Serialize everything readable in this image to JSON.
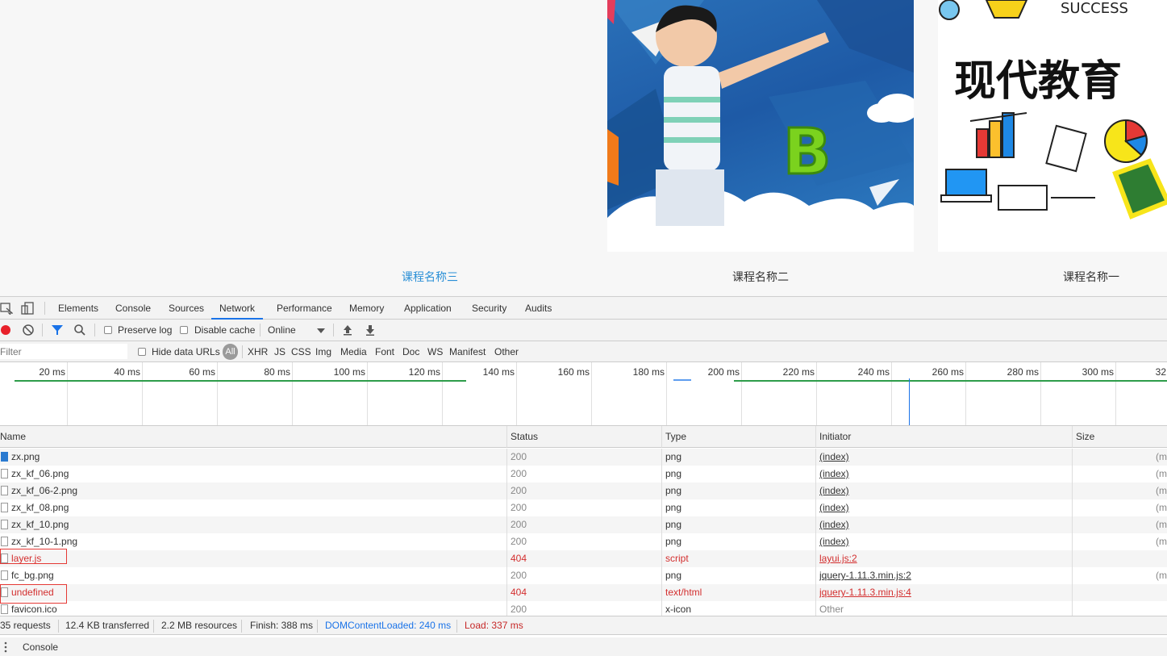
{
  "courses": [
    "课程名称三",
    "课程名称二",
    "课程名称一"
  ],
  "hero_images": {
    "image1_text": "B",
    "image2_title": "现代教育",
    "image2_top": "SUCCESS"
  },
  "devtools": {
    "tabs": [
      "Elements",
      "Console",
      "Sources",
      "Network",
      "Performance",
      "Memory",
      "Application",
      "Security",
      "Audits"
    ],
    "selected_tab": "Network",
    "toolbar": {
      "preserve_log": "Preserve log",
      "disable_cache": "Disable cache",
      "throttle": "Online"
    },
    "filterbar": {
      "placeholder": "Filter",
      "hide_data_urls": "Hide data URLs",
      "all": "All",
      "types": [
        "XHR",
        "JS",
        "CSS",
        "Img",
        "Media",
        "Font",
        "Doc",
        "WS",
        "Manifest",
        "Other"
      ]
    },
    "timeline_ticks": [
      "20 ms",
      "40 ms",
      "60 ms",
      "80 ms",
      "100 ms",
      "120 ms",
      "140 ms",
      "160 ms",
      "180 ms",
      "200 ms",
      "220 ms",
      "240 ms",
      "260 ms",
      "280 ms",
      "300 ms",
      "32"
    ],
    "columns": [
      "Name",
      "Status",
      "Type",
      "Initiator",
      "Size"
    ],
    "rows": [
      {
        "name": "zx.png",
        "status": "200",
        "type": "png",
        "initiator": "(index)",
        "size": "(m"
      },
      {
        "name": "zx_kf_06.png",
        "status": "200",
        "type": "png",
        "initiator": "(index)",
        "size": "(m"
      },
      {
        "name": "zx_kf_06-2.png",
        "status": "200",
        "type": "png",
        "initiator": "(index)",
        "size": "(m"
      },
      {
        "name": "zx_kf_08.png",
        "status": "200",
        "type": "png",
        "initiator": "(index)",
        "size": "(m"
      },
      {
        "name": "zx_kf_10.png",
        "status": "200",
        "type": "png",
        "initiator": "(index)",
        "size": "(m"
      },
      {
        "name": "zx_kf_10-1.png",
        "status": "200",
        "type": "png",
        "initiator": "(index)",
        "size": "(m"
      },
      {
        "name": "layer.js",
        "status": "404",
        "type": "script",
        "initiator": "layui.js:2",
        "size": ""
      },
      {
        "name": "fc_bg.png",
        "status": "200",
        "type": "png",
        "initiator": "jquery-1.11.3.min.js:2",
        "size": "(m"
      },
      {
        "name": "undefined",
        "status": "404",
        "type": "text/html",
        "initiator": "jquery-1.11.3.min.js:4",
        "size": ""
      },
      {
        "name": "favicon.ico",
        "status": "200",
        "type": "x-icon",
        "initiator": "Other",
        "size": ""
      }
    ],
    "summary": {
      "requests": "35 requests",
      "transferred": "12.4 KB transferred",
      "resources": "2.2 MB resources",
      "finish": "Finish: 388 ms",
      "dom": "DOMContentLoaded: 240 ms",
      "load": "Load: 337 ms"
    },
    "drawer_label": "Console"
  },
  "colors": {
    "accent": "#1a73e8",
    "error": "#d32f2f",
    "course_active": "#2a8fd6"
  }
}
